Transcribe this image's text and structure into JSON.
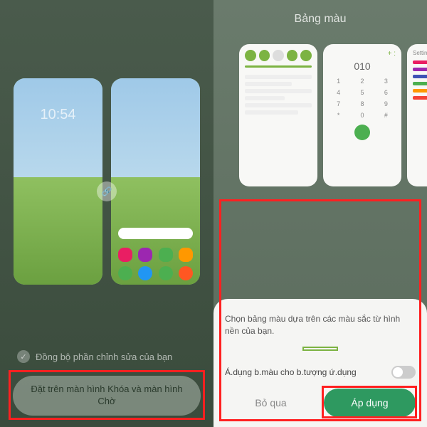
{
  "left": {
    "clock": "10:54",
    "sync_label": "Đồng bộ phần chỉnh sửa của bạn",
    "set_button": "Đặt trên màn hình Khóa và màn hình Chờ"
  },
  "right": {
    "title": "Bảng màu",
    "dialer_display": "010",
    "digits": [
      "1",
      "2",
      "3",
      "4",
      "5",
      "6",
      "7",
      "8",
      "9",
      "*",
      "0",
      "#"
    ],
    "settings_label": "Settings",
    "sheet": {
      "description": "Chọn bảng màu dựa trên các màu sắc từ hình nền của bạn.",
      "palettes": [
        {
          "selected": false,
          "colors": [
            "#2d8fd6",
            "#1a5fa8",
            "#e8e8e8",
            "#1a1a1a"
          ]
        },
        {
          "selected": false,
          "colors": [
            "#a8d8b8",
            "#88c8a0",
            "#c8e8d0",
            "#68a880"
          ]
        },
        {
          "selected": true,
          "colors": [
            "#a8d858",
            "#88c840",
            "#c8e880",
            "#68a820"
          ]
        },
        {
          "selected": false,
          "colors": [
            "#b8d890",
            "#98c870",
            "#d8e8b0",
            "#78a850"
          ]
        },
        {
          "selected": false,
          "colors": [
            "#c8d868",
            "#a8c850",
            "#e0e8a0",
            "#88a830"
          ]
        }
      ],
      "apply_icons_label": "Á.dụng b.màu cho b.tượng ứ.dụng",
      "apply_icons_on": false,
      "skip_label": "Bỏ qua",
      "apply_label": "Áp dụng"
    }
  }
}
